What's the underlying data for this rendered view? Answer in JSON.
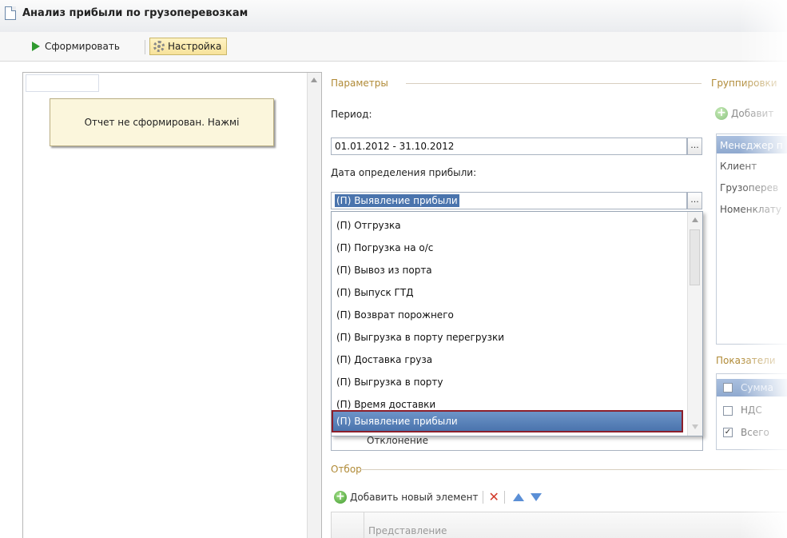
{
  "window": {
    "title": "Анализ прибыли по грузоперевозкам"
  },
  "toolbar": {
    "run_label": "Сформировать",
    "settings_label": "Настройка"
  },
  "left_panel": {
    "notice": "Отчет не сформирован. Нажмі"
  },
  "params": {
    "section_title": "Параметры",
    "period_label": "Период:",
    "period_value": "01.01.2012 - 31.10.2012",
    "ellipsis": "...",
    "profit_date_label": "Дата определения прибыли:",
    "profit_date_value": "(П) Выявление прибыли"
  },
  "dropdown": {
    "items": [
      "(П) Отгрузка",
      "(П) Погрузка на о/с",
      "(П) Вывоз из порта",
      "(П) Выпуск ГТД",
      "(П) Возврат порожнего",
      "(П) Выгрузка в порту перегрузки",
      "(П) Доставка груза",
      "(П) Выгрузка в порту",
      "(П) Время доставки"
    ],
    "selected": "(П) Выявление прибыли",
    "behind_text": "Отклонение"
  },
  "groupings": {
    "section_title": "Группировки",
    "add_label": "Добавит",
    "items": [
      "Менеджер п",
      "Клиент",
      "Грузоперев",
      "Номенклату"
    ]
  },
  "indicators": {
    "section_title": "Показатели",
    "items": [
      {
        "label": "Сумма",
        "checked": false
      },
      {
        "label": "НДС",
        "checked": false
      },
      {
        "label": "Всего",
        "checked": true
      }
    ],
    "check_mark": "✓"
  },
  "filter": {
    "section_title": "Отбор",
    "add_label": "Добавить новый элемент",
    "delete_glyph": "✕",
    "column_header": "Представление"
  },
  "colors": {
    "accent": "#4a74ad",
    "section": "#b08a36",
    "selection_border": "#8c1f2b"
  }
}
